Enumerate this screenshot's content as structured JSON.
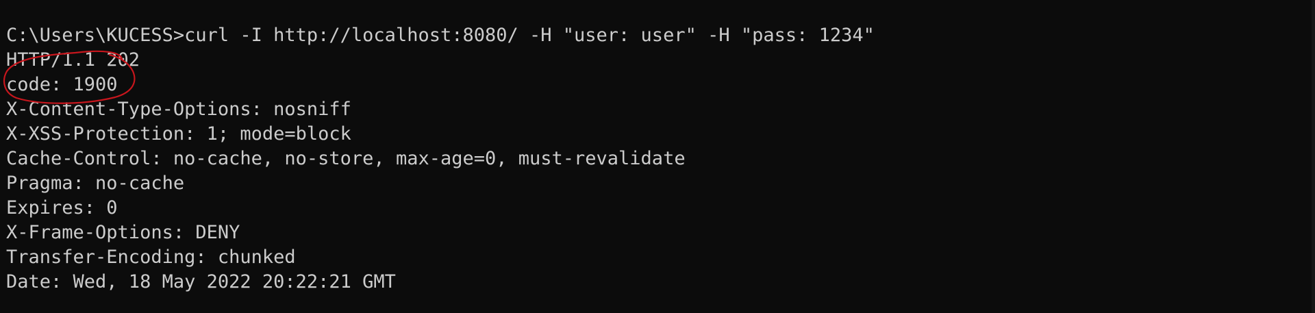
{
  "terminal": {
    "lines": [
      "C:\\Users\\KUCESS>curl -I http://localhost:8080/ -H \"user: user\" -H \"pass: 1234\"",
      "HTTP/1.1 202",
      "code: 1900",
      "X-Content-Type-Options: nosniff",
      "X-XSS-Protection: 1; mode=block",
      "Cache-Control: no-cache, no-store, max-age=0, must-revalidate",
      "Pragma: no-cache",
      "Expires: 0",
      "X-Frame-Options: DENY",
      "Transfer-Encoding: chunked",
      "Date: Wed, 18 May 2022 20:22:21 GMT"
    ]
  },
  "colors": {
    "background": "#0c0c0c",
    "text": "#cccccc",
    "annotation": "#c8161d"
  }
}
